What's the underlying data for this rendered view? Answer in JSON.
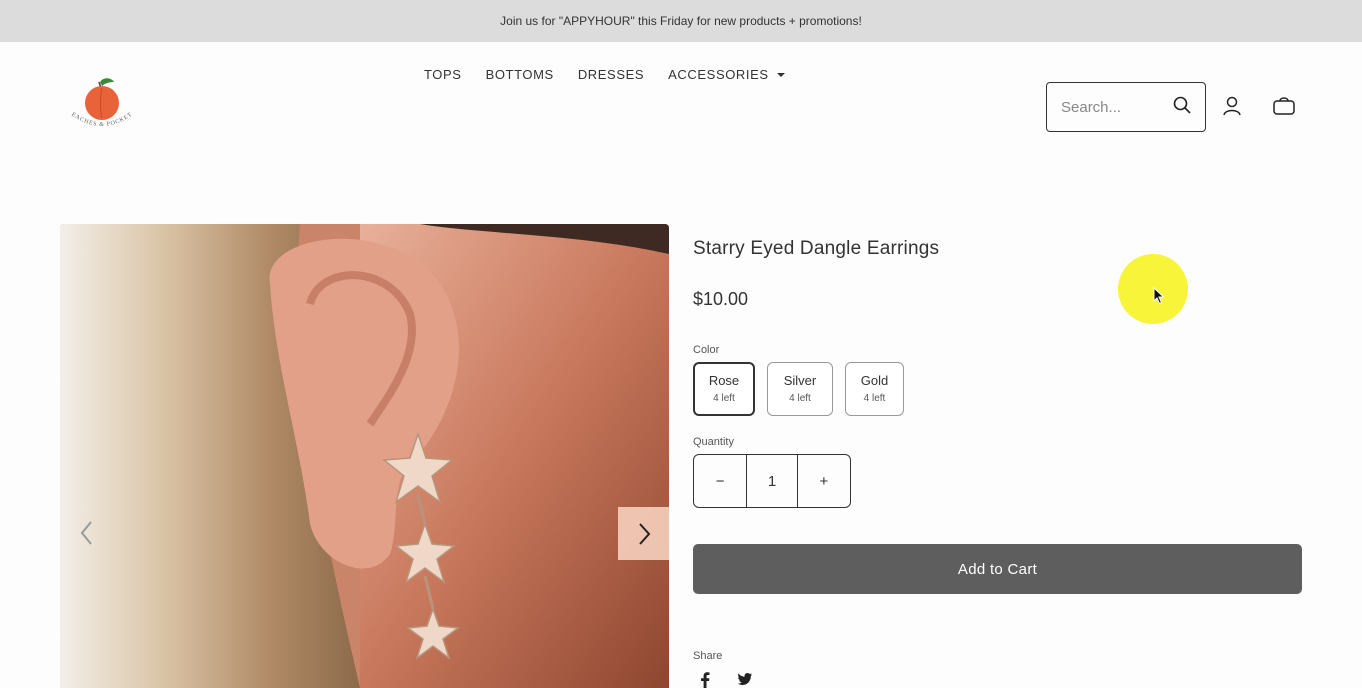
{
  "announcement": "Join us for \"APPYHOUR\" this Friday for new products + promotions!",
  "brand": {
    "logo_text": "PEACHES & POCKETS"
  },
  "nav": [
    {
      "label": "TOPS"
    },
    {
      "label": "BOTTOMS"
    },
    {
      "label": "DRESSES"
    },
    {
      "label": "ACCESSORIES"
    }
  ],
  "search": {
    "placeholder": "Search..."
  },
  "header_icons": [
    "search-icon",
    "account-icon",
    "cart-icon"
  ],
  "product": {
    "title": "Starry Eyed Dangle Earrings",
    "price": "$10.00",
    "color_label": "Color",
    "colors": [
      {
        "name": "Rose",
        "stock": "4 left",
        "selected": true
      },
      {
        "name": "Silver",
        "stock": "4 left",
        "selected": false
      },
      {
        "name": "Gold",
        "stock": "4 left",
        "selected": false
      }
    ],
    "quantity_label": "Quantity",
    "quantity": {
      "minus": "−",
      "value": "1",
      "plus": "+"
    },
    "add_to_cart": "Add to Cart",
    "share_label": "Share",
    "share_icons": [
      "facebook-icon",
      "twitter-icon"
    ]
  },
  "colors": {
    "announce_bg": "#dcdcdc",
    "button_bg": "#5e5e5e",
    "peach": "#e8623a",
    "cursor_highlight": "#f7f43a"
  }
}
